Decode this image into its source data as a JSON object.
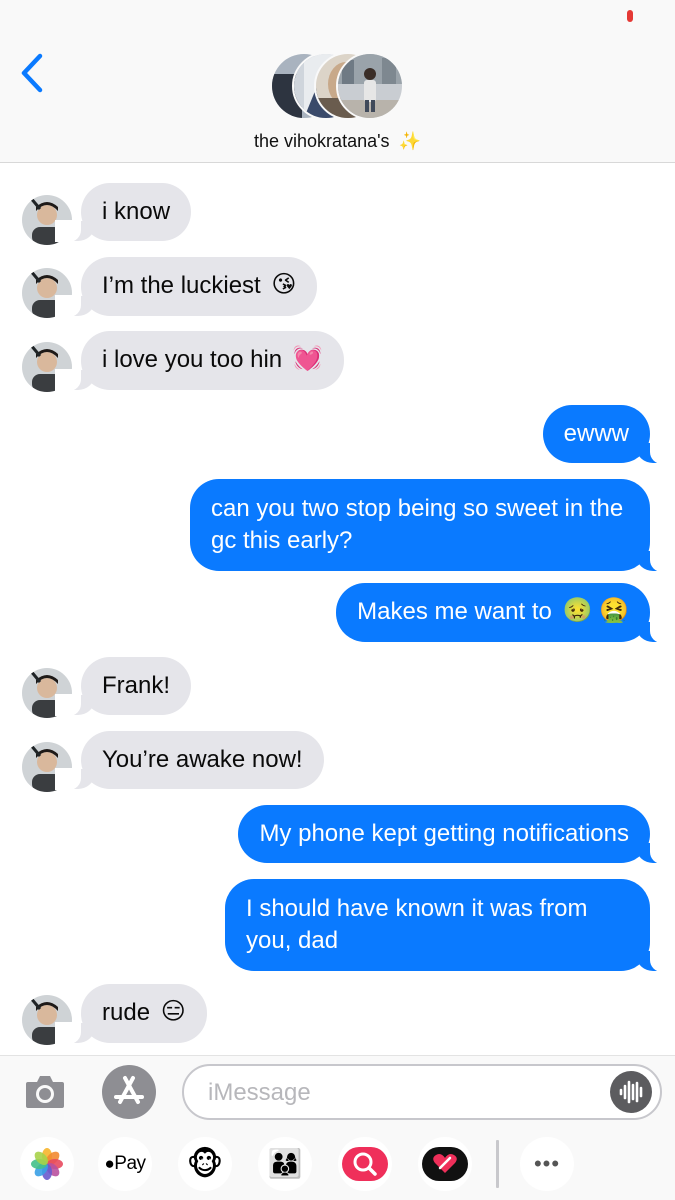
{
  "header": {
    "back_icon": "chevron-left-icon",
    "title": "the vihokratana's",
    "title_emoji": "✨",
    "accent_color": "#0a7aff",
    "participant_count": 4
  },
  "messages": [
    {
      "direction": "in",
      "text": "i know",
      "emoji": ""
    },
    {
      "direction": "in",
      "text": "I’m the luckiest",
      "emoji": "😘"
    },
    {
      "direction": "in",
      "text": "i love you too hin",
      "emoji": "💓"
    },
    {
      "direction": "out",
      "text": "ewww",
      "emoji": ""
    },
    {
      "direction": "out",
      "text": "can you two stop being so sweet in the gc this early?",
      "emoji": ""
    },
    {
      "direction": "out",
      "text": "Makes me want to",
      "emoji": "🤢 🤮"
    },
    {
      "direction": "in",
      "text": "Frank!",
      "emoji": ""
    },
    {
      "direction": "in",
      "text": "You’re awake now!",
      "emoji": ""
    },
    {
      "direction": "out",
      "text": "My phone kept getting notifications",
      "emoji": ""
    },
    {
      "direction": "out",
      "text": "I should have known it was from you, dad",
      "emoji": ""
    },
    {
      "direction": "in",
      "text": "rude",
      "emoji": "😑"
    }
  ],
  "colors": {
    "incoming_bubble": "#e5e5ea",
    "outgoing_bubble": "#0a7aff",
    "outgoing_text": "#ffffff"
  },
  "input": {
    "placeholder": "iMessage",
    "value": "",
    "camera_icon": "camera-icon",
    "appstore_icon": "app-store-icon",
    "audio_icon": "audio-waveform-icon"
  },
  "app_drawer": {
    "items": [
      {
        "name": "photos-app-icon"
      },
      {
        "name": "apple-pay-icon",
        "label": "Pay"
      },
      {
        "name": "animoji-icon",
        "emoji": "🐵"
      },
      {
        "name": "memoji-icon",
        "emoji": "👨‍👩‍👦"
      },
      {
        "name": "search-images-icon"
      },
      {
        "name": "digital-touch-icon"
      },
      {
        "name": "more-apps-icon",
        "label": "•••"
      }
    ]
  }
}
